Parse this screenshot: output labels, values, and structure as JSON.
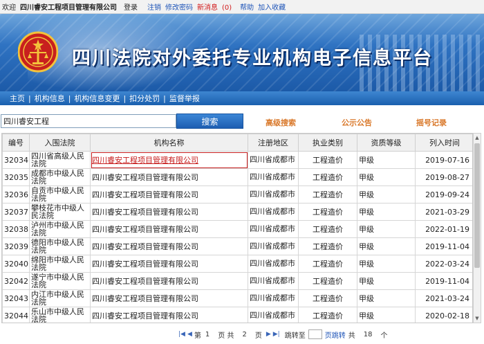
{
  "topbar": {
    "welcome": "欢迎",
    "company": "四川睿安工程项目管理有限公司",
    "login": "登录",
    "logout": "注销",
    "change_password": "修改密码",
    "new_messages_label": "新消息",
    "new_messages_count": "(0)",
    "help": "帮助",
    "favorite": "加入收藏"
  },
  "banner": {
    "title": "四川法院对外委托专业机构电子信息平台"
  },
  "nav": {
    "items": [
      "主页",
      "机构信息",
      "机构信息变更",
      "扣分处罚",
      "监督举报"
    ]
  },
  "search": {
    "value": "四川睿安工程",
    "button_label": "搜索",
    "advanced_label": "高级搜索",
    "notice_label": "公示公告",
    "record_label": "摇号记录"
  },
  "table": {
    "columns": [
      "编号",
      "入围法院",
      "机构名称",
      "注册地区",
      "执业类别",
      "资质等级",
      "列入时间"
    ],
    "rows": [
      [
        "32034",
        "四川省高级人民法院",
        "四川睿安工程项目管理有限公司",
        "四川省成都市",
        "工程造价",
        "甲级",
        "2019-07-16"
      ],
      [
        "32035",
        "成都市中级人民法院",
        "四川睿安工程项目管理有限公司",
        "四川省成都市",
        "工程造价",
        "甲级",
        "2019-08-27"
      ],
      [
        "32036",
        "自贡市中级人民法院",
        "四川睿安工程项目管理有限公司",
        "四川省成都市",
        "工程造价",
        "甲级",
        "2019-09-24"
      ],
      [
        "32037",
        "攀枝花市中级人民法院",
        "四川睿安工程项目管理有限公司",
        "四川省成都市",
        "工程造价",
        "甲级",
        "2021-03-29"
      ],
      [
        "32038",
        "泸州市中级人民法院",
        "四川睿安工程项目管理有限公司",
        "四川省成都市",
        "工程造价",
        "甲级",
        "2022-01-19"
      ],
      [
        "32039",
        "德阳市中级人民法院",
        "四川睿安工程项目管理有限公司",
        "四川省成都市",
        "工程造价",
        "甲级",
        "2019-11-04"
      ],
      [
        "32040",
        "绵阳市中级人民法院",
        "四川睿安工程项目管理有限公司",
        "四川省成都市",
        "工程造价",
        "甲级",
        "2022-03-24"
      ],
      [
        "32042",
        "遂宁市中级人民法院",
        "四川睿安工程项目管理有限公司",
        "四川省成都市",
        "工程造价",
        "甲级",
        "2019-11-04"
      ],
      [
        "32043",
        "内江市中级人民法院",
        "四川睿安工程项目管理有限公司",
        "四川省成都市",
        "工程造价",
        "甲级",
        "2021-03-24"
      ],
      [
        "32044",
        "乐山市中级人民法院",
        "四川睿安工程项目管理有限公司",
        "四川省成都市",
        "工程造价",
        "甲级",
        "2020-02-18"
      ]
    ]
  },
  "pager": {
    "first_icon": "first-page-icon",
    "prev_icon": "prev-page-icon",
    "page_label": "第",
    "current_page": "1",
    "page_unit": "页 共",
    "total_pages": "2",
    "page_unit2": "页",
    "next_icon": "next-page-icon",
    "last_icon": "last-page-icon",
    "jump_label": "跳转至",
    "go_label": "页跳转",
    "total_label": "共",
    "total_count": "18",
    "count_unit": "个"
  },
  "colors": {
    "banner_blue": "#1c5aa8",
    "nav_blue": "#1a5fae",
    "link_orange": "#d9782a",
    "selected_red": "#c61a1a"
  }
}
